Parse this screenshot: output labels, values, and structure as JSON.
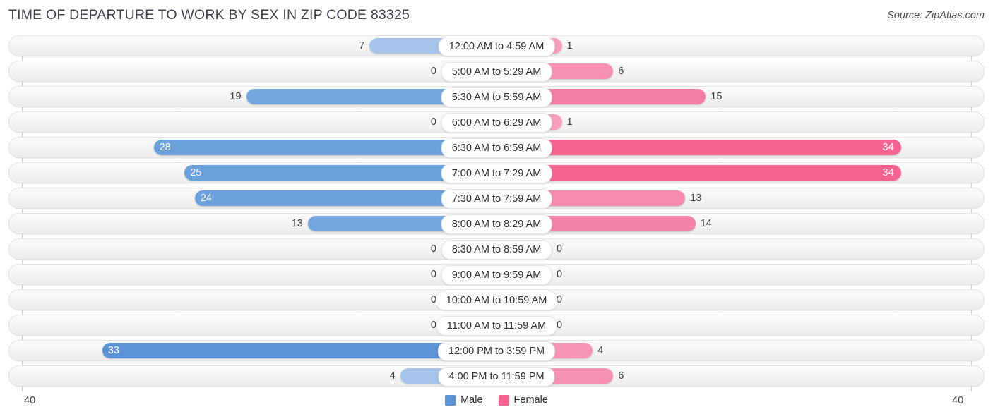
{
  "title": "TIME OF DEPARTURE TO WORK BY SEX IN ZIP CODE 83325",
  "source": "Source: ZipAtlas.com",
  "legend": {
    "male": {
      "label": "Male",
      "color": "#5b93d6"
    },
    "female": {
      "label": "Female",
      "color": "#f4648f"
    }
  },
  "axis": {
    "left_tick": "40",
    "right_tick": "40",
    "max": 40
  },
  "chart_data": {
    "type": "bar",
    "subtype": "diverging-horizontal",
    "title": "TIME OF DEPARTURE TO WORK BY SEX IN ZIP CODE 83325",
    "xlabel": "",
    "ylabel": "",
    "xlim": [
      0,
      40
    ],
    "grid": false,
    "legend_position": "bottom-center",
    "categories": [
      "12:00 AM to 4:59 AM",
      "5:00 AM to 5:29 AM",
      "5:30 AM to 5:59 AM",
      "6:00 AM to 6:29 AM",
      "6:30 AM to 6:59 AM",
      "7:00 AM to 7:29 AM",
      "7:30 AM to 7:59 AM",
      "8:00 AM to 8:29 AM",
      "8:30 AM to 8:59 AM",
      "9:00 AM to 9:59 AM",
      "10:00 AM to 10:59 AM",
      "11:00 AM to 11:59 AM",
      "12:00 PM to 3:59 PM",
      "4:00 PM to 11:59 PM"
    ],
    "series": [
      {
        "name": "Male",
        "direction": "left",
        "values": [
          7,
          0,
          19,
          0,
          28,
          25,
          24,
          13,
          0,
          0,
          0,
          0,
          33,
          4
        ]
      },
      {
        "name": "Female",
        "direction": "right",
        "values": [
          1,
          6,
          15,
          1,
          34,
          34,
          13,
          14,
          0,
          0,
          0,
          0,
          4,
          6
        ]
      }
    ]
  },
  "rows": [
    {
      "label": "12:00 AM to 4:59 AM",
      "male": "7",
      "female": "1",
      "male_val": 7,
      "female_val": 1,
      "male_color": "#a5c6ea",
      "female_color": "#f79ebc",
      "male_inside": false,
      "female_inside": false
    },
    {
      "label": "5:00 AM to 5:29 AM",
      "male": "0",
      "female": "6",
      "male_val": 0,
      "female_val": 6,
      "male_color": "#aec9ec",
      "female_color": "#f791b4",
      "male_inside": false,
      "female_inside": false
    },
    {
      "label": "5:30 AM to 5:59 AM",
      "male": "19",
      "female": "15",
      "male_val": 19,
      "female_val": 15,
      "male_color": "#74a6de",
      "female_color": "#f47ea6",
      "male_inside": false,
      "female_inside": false
    },
    {
      "label": "6:00 AM to 6:29 AM",
      "male": "0",
      "female": "1",
      "male_val": 0,
      "female_val": 1,
      "male_color": "#aec9ec",
      "female_color": "#f79ebc",
      "male_inside": false,
      "female_inside": false
    },
    {
      "label": "6:30 AM to 6:59 AM",
      "male": "28",
      "female": "34",
      "male_val": 28,
      "female_val": 34,
      "male_color": "#6aa0dc",
      "female_color": "#f4648f",
      "male_inside": true,
      "female_inside": true
    },
    {
      "label": "7:00 AM to 7:29 AM",
      "male": "25",
      "female": "34",
      "male_val": 25,
      "female_val": 34,
      "male_color": "#6aa0dc",
      "female_color": "#f4648f",
      "male_inside": true,
      "female_inside": true
    },
    {
      "label": "7:30 AM to 7:59 AM",
      "male": "24",
      "female": "13",
      "male_val": 24,
      "female_val": 13,
      "male_color": "#6aa0dc",
      "female_color": "#f48cb0",
      "male_inside": true,
      "female_inside": false
    },
    {
      "label": "8:00 AM to 8:29 AM",
      "male": "13",
      "female": "14",
      "male_val": 13,
      "female_val": 14,
      "male_color": "#74a6de",
      "female_color": "#f482a9",
      "male_inside": false,
      "female_inside": false
    },
    {
      "label": "8:30 AM to 8:59 AM",
      "male": "0",
      "female": "0",
      "male_val": 0,
      "female_val": 0,
      "male_color": "#aec9ec",
      "female_color": "#f79ebc",
      "male_inside": false,
      "female_inside": false
    },
    {
      "label": "9:00 AM to 9:59 AM",
      "male": "0",
      "female": "0",
      "male_val": 0,
      "female_val": 0,
      "male_color": "#aec9ec",
      "female_color": "#f79ebc",
      "male_inside": false,
      "female_inside": false
    },
    {
      "label": "10:00 AM to 10:59 AM",
      "male": "0",
      "female": "0",
      "male_val": 0,
      "female_val": 0,
      "male_color": "#aec9ec",
      "female_color": "#f79ebc",
      "male_inside": false,
      "female_inside": false
    },
    {
      "label": "11:00 AM to 11:59 AM",
      "male": "0",
      "female": "0",
      "male_val": 0,
      "female_val": 0,
      "male_color": "#aec9ec",
      "female_color": "#f79ebc",
      "male_inside": false,
      "female_inside": false
    },
    {
      "label": "12:00 PM to 3:59 PM",
      "male": "33",
      "female": "4",
      "male_val": 33,
      "female_val": 4,
      "male_color": "#5b93d6",
      "female_color": "#f795b7",
      "male_inside": true,
      "female_inside": false
    },
    {
      "label": "4:00 PM to 11:59 PM",
      "male": "4",
      "female": "6",
      "male_val": 4,
      "female_val": 6,
      "male_color": "#a5c6ea",
      "female_color": "#f791b4",
      "male_inside": false,
      "female_inside": false
    }
  ]
}
